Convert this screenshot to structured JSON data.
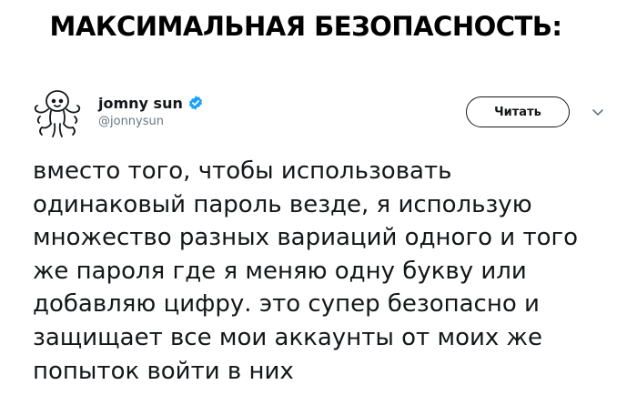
{
  "caption": "МАКСИМАЛЬНАЯ БЕЗОПАСНОСТЬ:",
  "tweet": {
    "author": {
      "display_name": "jomny sun",
      "handle": "@jonnysun",
      "avatar_icon": "doodle-character-avatar-icon",
      "verified_icon": "verified-badge-icon"
    },
    "follow_label": "Читать",
    "menu_icon": "chevron-down-icon",
    "text_lines": [
      "вместо того, чтобы использовать",
      "одинаковый пароль везде, я использую",
      "множество разных вариаций одного и того",
      "же пароля где я меняю одну букву или",
      "добавляю цифру. это супер безопасно и",
      "защищает все мои аккаунты от моих же",
      "попыток войти в них"
    ]
  },
  "colors": {
    "text": "#14171a",
    "secondary": "#657786",
    "verified": "#1da1f2",
    "caption": "#000000"
  }
}
